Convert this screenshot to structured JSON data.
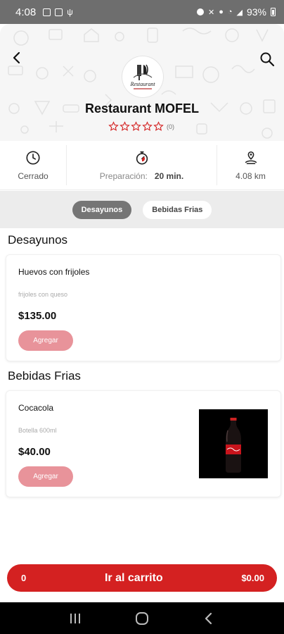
{
  "status": {
    "time": "4:08",
    "battery": "93%"
  },
  "restaurant": {
    "name": "Restaurant MOFEL",
    "logo_text": "Restaurant",
    "rating_count": "(0)",
    "stars_filled": 0,
    "stars_total": 5
  },
  "info": {
    "status_label": "Cerrado",
    "prep_label": "Preparación:",
    "prep_value": "20 min.",
    "distance": "4.08 km"
  },
  "tabs": [
    {
      "label": "Desayunos",
      "active": true
    },
    {
      "label": "Bebidas Frias",
      "active": false
    }
  ],
  "sections": [
    {
      "title": "Desayunos",
      "products": [
        {
          "name": "Huevos con frijoles",
          "description": "frijoles con queso",
          "price": "$135.00",
          "button": "Agregar",
          "has_image": false
        }
      ]
    },
    {
      "title": "Bebidas Frias",
      "products": [
        {
          "name": "Cocacola",
          "description": "Botella 600ml",
          "price": "$40.00",
          "button": "Agregar",
          "has_image": true
        }
      ]
    }
  ],
  "cart": {
    "count": "0",
    "label": "Ir al carrito",
    "total": "$0.00"
  },
  "colors": {
    "accent": "#d42121",
    "add_button": "#e8939a",
    "status_bar": "#6e6e6e",
    "active_tab": "#757575"
  },
  "icons": [
    "back-icon",
    "search-icon",
    "clock-icon",
    "stopwatch-icon",
    "location-icon",
    "star-icon"
  ]
}
